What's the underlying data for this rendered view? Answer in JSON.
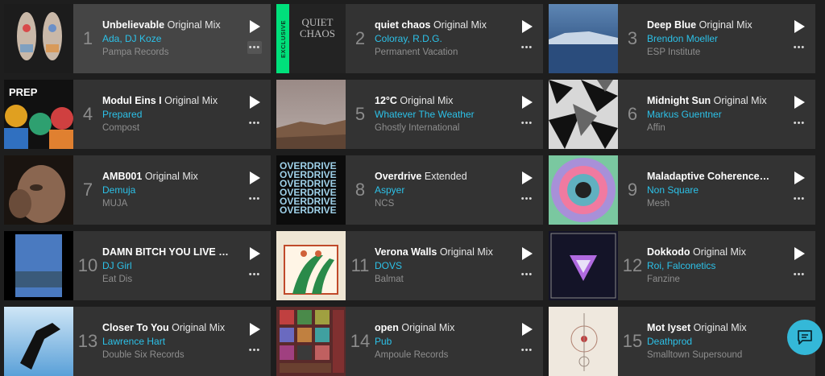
{
  "tracks": [
    {
      "rank": "1",
      "title": "Unbelievable",
      "mix": "Original Mix",
      "artist": "Ada, DJ Koze",
      "label": "Pampa Records"
    },
    {
      "rank": "2",
      "title": "quiet chaos",
      "mix": "Original Mix",
      "artist": "Coloray, R.D.G.",
      "label": "Permanent Vacation",
      "badge": "EXCLUSIVE",
      "cover_text": "QUIET CHAOS"
    },
    {
      "rank": "3",
      "title": "Deep Blue",
      "mix": "Original Mix",
      "artist": "Brendon Moeller",
      "label": "ESP Institute"
    },
    {
      "rank": "4",
      "title": "Modul Eins I",
      "mix": "Original Mix",
      "artist": "Prepared",
      "label": "Compost",
      "cover_text": "PREP"
    },
    {
      "rank": "5",
      "title": "12°C",
      "mix": "Original Mix",
      "artist": "Whatever The Weather",
      "label": "Ghostly International"
    },
    {
      "rank": "6",
      "title": "Midnight Sun",
      "mix": "Original Mix",
      "artist": "Markus Guentner",
      "label": "Affin"
    },
    {
      "rank": "7",
      "title": "AMB001",
      "mix": "Original Mix",
      "artist": "Demuja",
      "label": "MUJA"
    },
    {
      "rank": "8",
      "title": "Overdrive",
      "mix": "Extended",
      "artist": "Aspyer",
      "label": "NCS",
      "cover_text": "OVERDRIVE"
    },
    {
      "rank": "9",
      "title": "Maladaptive Coherence…",
      "mix": "",
      "artist": "Non Square",
      "label": "Mesh"
    },
    {
      "rank": "10",
      "title": "DAMN BITCH YOU LIVE …",
      "mix": "",
      "artist": "DJ Girl",
      "label": "Eat Dis"
    },
    {
      "rank": "11",
      "title": "Verona Walls",
      "mix": "Original Mix",
      "artist": "DOVS",
      "label": "Balmat"
    },
    {
      "rank": "12",
      "title": "Dokkodo",
      "mix": "Original Mix",
      "artist": "Roi, Falconetics",
      "label": "Fanzine"
    },
    {
      "rank": "13",
      "title": "Closer To You",
      "mix": "Original Mix",
      "artist": "Lawrence Hart",
      "label": "Double Six Records"
    },
    {
      "rank": "14",
      "title": "open",
      "mix": "Original Mix",
      "artist": "Pub",
      "label": "Ampoule Records"
    },
    {
      "rank": "15",
      "title": "Mot Iyset",
      "mix": "Original Mix",
      "artist": "Deathprod",
      "label": "Smalltown Supersound"
    }
  ],
  "more_label": "•••",
  "icons": {
    "play": "play-icon",
    "more": "more-icon",
    "chat": "chat-icon"
  },
  "colors": {
    "artist": "#2cc1e8",
    "exclusive": "#00e07b",
    "chat": "#34b8d8"
  }
}
